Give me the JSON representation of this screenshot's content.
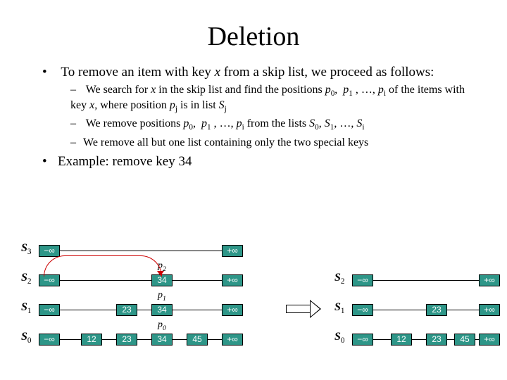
{
  "title": "Deletion",
  "bullets": {
    "b1": "To remove an item with key ",
    "b1_var": "x",
    "b1_tail": " from a skip list, we proceed as follows:",
    "s1a": "We search for ",
    "s1b": " in the skip list and find the positions ",
    "s1c": " of the items with key ",
    "s1d": ", where position ",
    "s1e": " is in list ",
    "s2a": "We remove positions ",
    "s2b": " from the lists ",
    "s3": "We remove all but one list containing only the two special keys",
    "b2": "Example: remove key 34"
  },
  "labels": {
    "S3": "S",
    "S3s": "3",
    "S2": "S",
    "S2s": "2",
    "S1": "S",
    "S1s": "1",
    "S0": "S",
    "S0s": "0",
    "p0": "p",
    "p0s": "0",
    "p1": "p",
    "p1s": "1",
    "p2": "p",
    "p2s": "2",
    "pi": "p",
    "pis": "i",
    "pj": "p",
    "pjs": "j",
    "Sj": "S",
    "Sjs": "j",
    "Si": "S",
    "Sis": "i",
    "Scap0": "S",
    "Scap0s": "0",
    "Scap1": "S",
    "Scap1s": "1"
  },
  "sym": {
    "minf": "−∞",
    "pinf": "+∞",
    "dots": ", …, ",
    "comma": ", "
  },
  "vals": {
    "v12": "12",
    "v23": "23",
    "v34": "34",
    "v45": "45"
  }
}
